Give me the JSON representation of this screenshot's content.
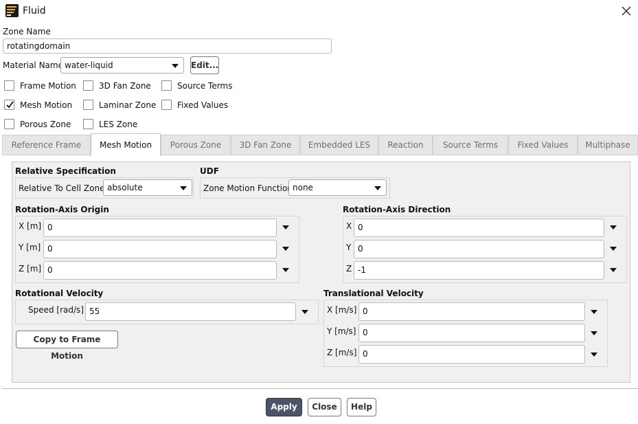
{
  "window": {
    "title": "Fluid",
    "icon": "fluent-app-icon"
  },
  "zone": {
    "label": "Zone Name",
    "value": "rotatingdomain"
  },
  "material": {
    "label": "Material Name",
    "value": "water-liquid",
    "edit_label": "Edit..."
  },
  "options": {
    "frame_motion": {
      "label": "Frame Motion",
      "checked": false
    },
    "fan_zone_3d": {
      "label": "3D Fan Zone",
      "checked": false
    },
    "source_terms": {
      "label": "Source Terms",
      "checked": false
    },
    "mesh_motion": {
      "label": "Mesh Motion",
      "checked": true
    },
    "laminar_zone": {
      "label": "Laminar Zone",
      "checked": false
    },
    "fixed_values": {
      "label": "Fixed Values",
      "checked": false
    },
    "porous_zone": {
      "label": "Porous Zone",
      "checked": false
    },
    "les_zone": {
      "label": "LES Zone",
      "checked": false
    }
  },
  "tabs": [
    {
      "label": "Reference Frame",
      "active": false
    },
    {
      "label": "Mesh Motion",
      "active": true
    },
    {
      "label": "Porous Zone",
      "active": false
    },
    {
      "label": "3D Fan Zone",
      "active": false
    },
    {
      "label": "Embedded LES",
      "active": false
    },
    {
      "label": "Reaction",
      "active": false
    },
    {
      "label": "Source Terms",
      "active": false
    },
    {
      "label": "Fixed Values",
      "active": false
    },
    {
      "label": "Multiphase",
      "active": false
    }
  ],
  "mesh_motion": {
    "relative_spec": {
      "heading": "Relative Specification",
      "label": "Relative To Cell Zone",
      "value": "absolute"
    },
    "udf": {
      "heading": "UDF",
      "label": "Zone Motion Function",
      "value": "none"
    },
    "axis_origin": {
      "heading": "Rotation-Axis Origin",
      "x": {
        "label": "X [m]",
        "value": "0"
      },
      "y": {
        "label": "Y [m]",
        "value": "0"
      },
      "z": {
        "label": "Z [m]",
        "value": "0"
      }
    },
    "axis_direction": {
      "heading": "Rotation-Axis Direction",
      "x": {
        "label": "X",
        "value": "0"
      },
      "y": {
        "label": "Y",
        "value": "0"
      },
      "z": {
        "label": "Z",
        "value": "-1"
      }
    },
    "rotational_velocity": {
      "heading": "Rotational Velocity",
      "label": "Speed [rad/s]",
      "value": "55"
    },
    "copy_button": "Copy to Frame Motion",
    "translational_velocity": {
      "heading": "Translational Velocity",
      "x": {
        "label": "X [m/s]",
        "value": "0"
      },
      "y": {
        "label": "Y [m/s]",
        "value": "0"
      },
      "z": {
        "label": "Z [m/s]",
        "value": "0"
      }
    }
  },
  "footer": {
    "apply": "Apply",
    "close": "Close",
    "help": "Help"
  }
}
